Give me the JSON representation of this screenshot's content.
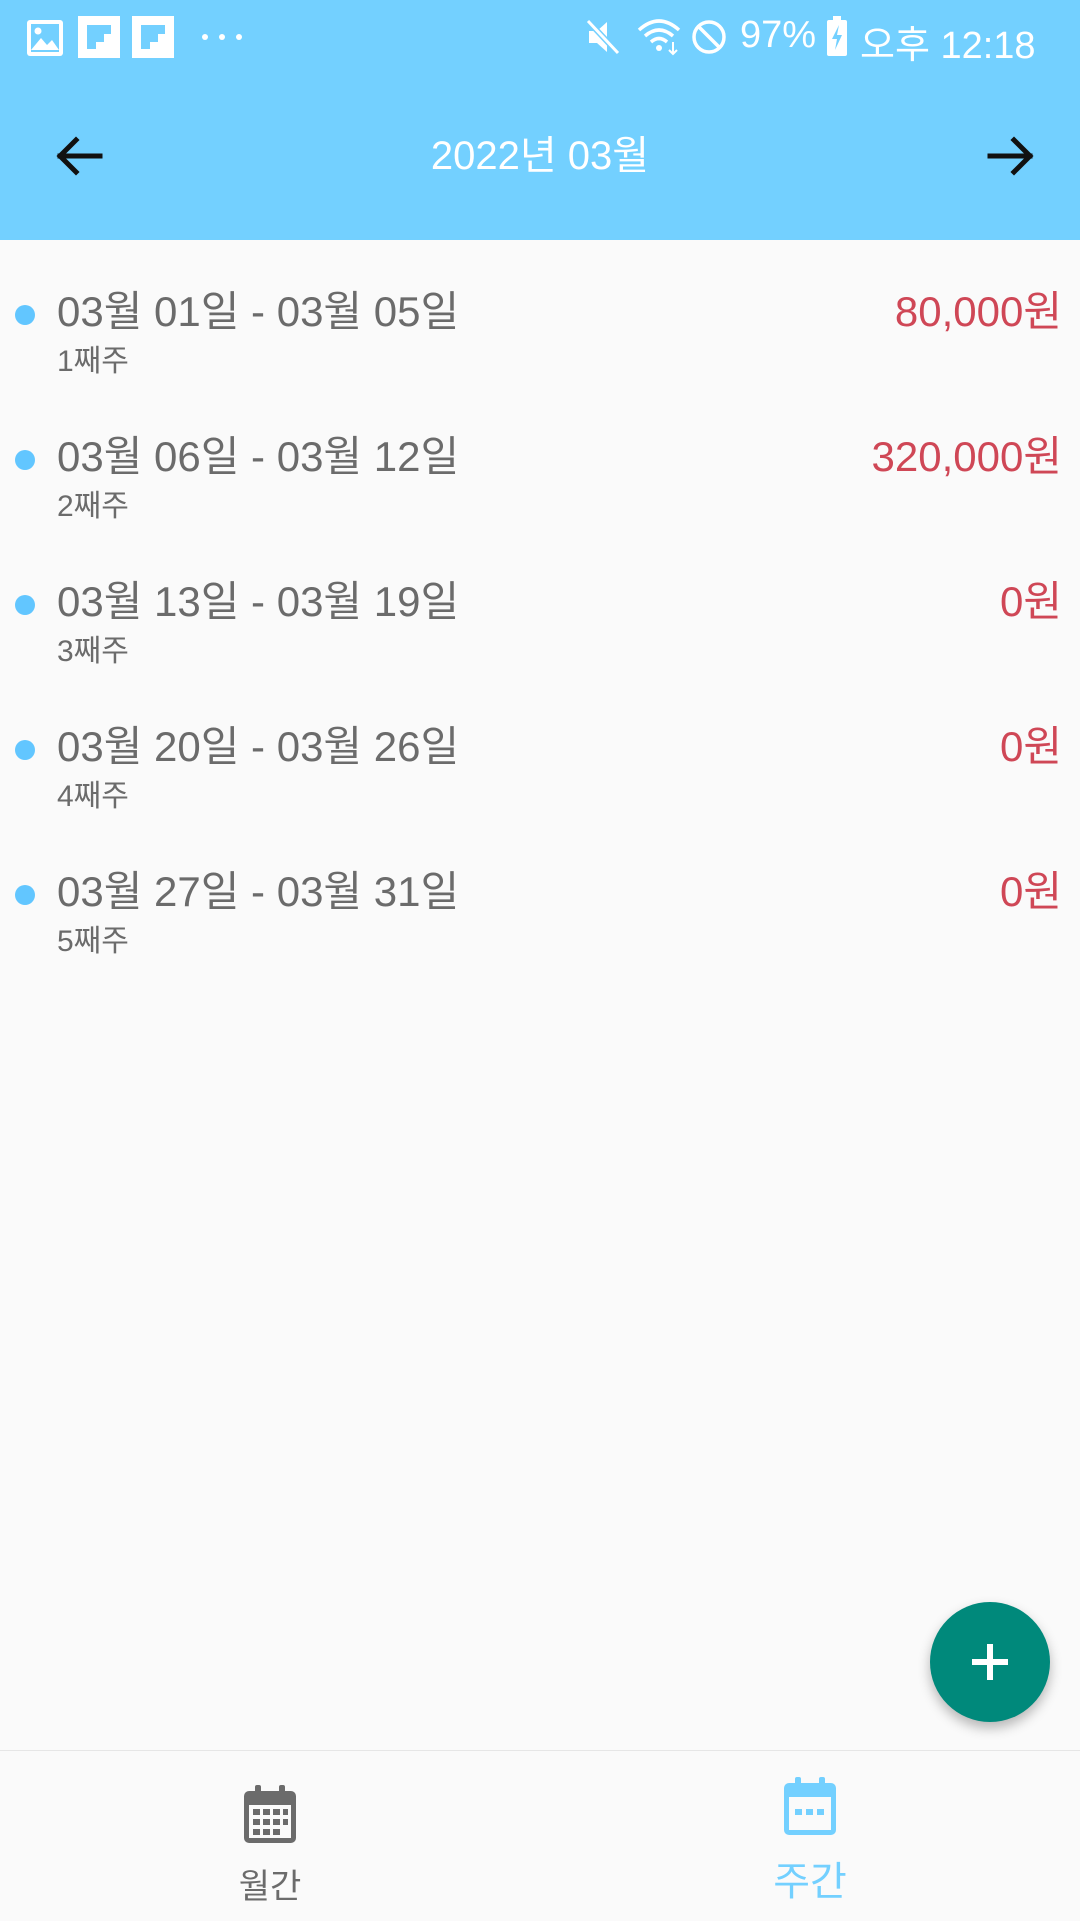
{
  "status_bar": {
    "battery": "97%",
    "time": "오후 12:18"
  },
  "header": {
    "title": "2022년 03월",
    "prev_icon": "arrow-left-icon",
    "next_icon": "arrow-right-icon"
  },
  "weeks": [
    {
      "range": "03월 01일 - 03월 05일",
      "label": "1째주",
      "amount": "80,000원"
    },
    {
      "range": "03월 06일 - 03월 12일",
      "label": "2째주",
      "amount": "320,000원"
    },
    {
      "range": "03월 13일 - 03월 19일",
      "label": "3째주",
      "amount": "0원"
    },
    {
      "range": "03월 20일 - 03월 26일",
      "label": "4째주",
      "amount": "0원"
    },
    {
      "range": "03월 27일 - 03월 31일",
      "label": "5째주",
      "amount": "0원"
    }
  ],
  "fab": {
    "icon": "plus-icon"
  },
  "bottom_nav": {
    "tabs": [
      {
        "label": "월간",
        "icon": "calendar-month-icon",
        "active": false
      },
      {
        "label": "주간",
        "icon": "calendar-week-icon",
        "active": true
      }
    ]
  },
  "colors": {
    "header": "#73d0ff",
    "amount": "#cf4756",
    "dot": "#62c6ff",
    "fab": "#00897b",
    "tab_active": "#73d0ff",
    "tab_inactive": "#6b6b6b"
  }
}
